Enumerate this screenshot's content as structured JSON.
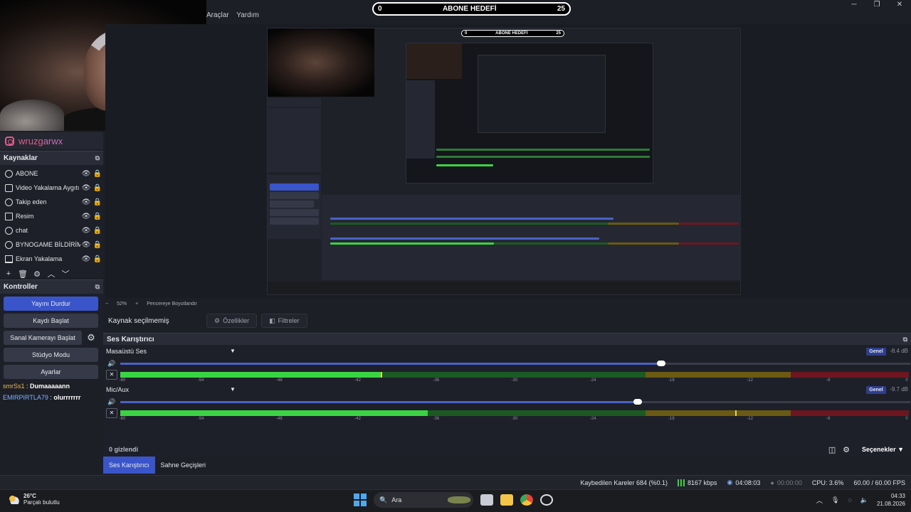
{
  "menu": [
    "Araçlar",
    "Yardım"
  ],
  "goal": {
    "left": "0",
    "title": "ABONE HEDEFİ",
    "right": "25"
  },
  "window_controls": [
    "─",
    "❐",
    "✕"
  ],
  "brand": {
    "part1": "wruzg",
    "part2": "arwx"
  },
  "sources": {
    "title": "Kaynaklar",
    "items": [
      {
        "label": "ABONE",
        "icon": "camera-icon"
      },
      {
        "label": "Video Yakalama Aygıtı",
        "icon": "video-capture-icon"
      },
      {
        "label": "Takip eden",
        "icon": "text-icon"
      },
      {
        "label": "Resim",
        "icon": "image-icon"
      },
      {
        "label": "chat",
        "icon": "browser-icon"
      },
      {
        "label": "BYNOGAME BİLDİRİM",
        "icon": "browser-icon"
      },
      {
        "label": "Ekran Yakalama",
        "icon": "display-capture-icon"
      }
    ]
  },
  "controls": {
    "title": "Kontroller",
    "stream": "Yayını Durdur",
    "record": "Kaydı Başlat",
    "vcam": "Sanal Kamerayı Başlat",
    "studio": "Stüdyo Modu",
    "settings": "Ayarlar"
  },
  "chat": [
    {
      "user": "smrSs1",
      "text": "Dumaaaaann"
    },
    {
      "user": "EMIRPIRTLA79",
      "text": "olurrrrrrr"
    }
  ],
  "zoombar": {
    "minus": "−",
    "zoom": "52%",
    "plus": "+",
    "fit": "Pencereye Boyutlandır"
  },
  "props": {
    "none": "Kaynak seçilmemiş",
    "properties": "Özellikler",
    "filters": "Filtreler"
  },
  "mixer": {
    "title": "Ses Karıştırıcı",
    "tracks": [
      {
        "name": "Masaüstü Ses",
        "genel": "Genel",
        "db": "-8.4 dB",
        "volume": 0.685,
        "level": 0.33,
        "peak": 0.33
      },
      {
        "name": "Mic/Aux",
        "genel": "Genel",
        "db": "-9.7 dB",
        "volume": 0.655,
        "level": 0.39,
        "peak": 0.78
      }
    ],
    "scale": [
      "-60",
      "-54",
      "-48",
      "-42",
      "-36",
      "-30",
      "-24",
      "-18",
      "-12",
      "-6",
      "0"
    ],
    "hidden": "0 gizlendi",
    "options": "Seçenekler"
  },
  "tabs": [
    "Ses Karıştırıcı",
    "Sahne Geçişleri"
  ],
  "status": {
    "dropped": "Kaybedilen Kareler 684 (%0.1)",
    "kbps": "8167 kbps",
    "stream_time": "04:08:03",
    "rec_time": "00:00:00",
    "cpu": "CPU: 3.6%",
    "fps": "60.00 / 60.00 FPS"
  },
  "taskbar": {
    "temp": "26°C",
    "weather": "Parçalı bulutlu",
    "search": "Ara",
    "time": "04:33",
    "date": "21.08.2026"
  },
  "colors": {
    "accent": "#3a55c9",
    "meter_green": "#3ad443",
    "brand": "#e35c8a"
  }
}
